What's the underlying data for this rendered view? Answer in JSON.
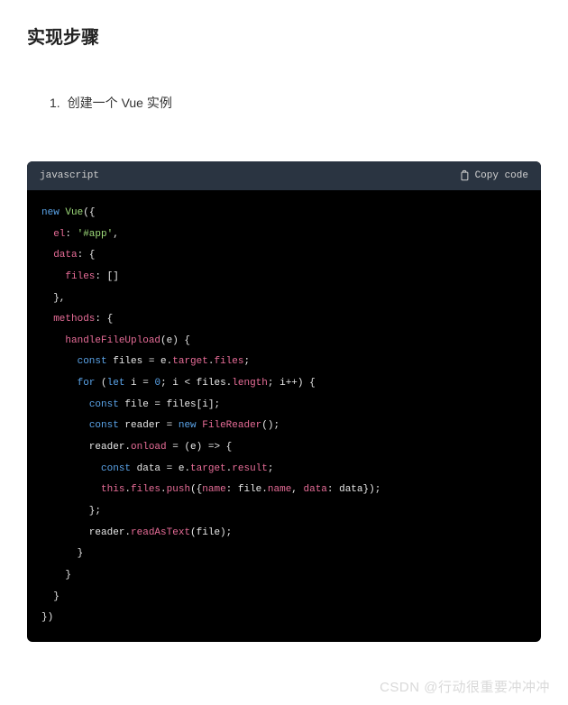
{
  "heading": "实现步骤",
  "list": {
    "number": "1.",
    "text": "创建一个 Vue 实例"
  },
  "code": {
    "language": "javascript",
    "copy_label": "Copy code",
    "lines": [
      [
        {
          "cls": "tk-kw",
          "t": "new"
        },
        {
          "cls": "tk-ident",
          "t": " "
        },
        {
          "cls": "tk-cls",
          "t": "Vue"
        },
        {
          "cls": "tk-punc",
          "t": "({"
        }
      ],
      [
        {
          "cls": "tk-ident",
          "t": "  "
        },
        {
          "cls": "tk-prop",
          "t": "el"
        },
        {
          "cls": "tk-punc",
          "t": ": "
        },
        {
          "cls": "tk-str",
          "t": "'#app'"
        },
        {
          "cls": "tk-punc",
          "t": ","
        }
      ],
      [
        {
          "cls": "tk-ident",
          "t": "  "
        },
        {
          "cls": "tk-prop",
          "t": "data"
        },
        {
          "cls": "tk-punc",
          "t": ": {"
        }
      ],
      [
        {
          "cls": "tk-ident",
          "t": "    "
        },
        {
          "cls": "tk-prop",
          "t": "files"
        },
        {
          "cls": "tk-punc",
          "t": ": []"
        }
      ],
      [
        {
          "cls": "tk-punc",
          "t": "  },"
        }
      ],
      [
        {
          "cls": "tk-ident",
          "t": "  "
        },
        {
          "cls": "tk-prop",
          "t": "methods"
        },
        {
          "cls": "tk-punc",
          "t": ": {"
        }
      ],
      [
        {
          "cls": "tk-ident",
          "t": "    "
        },
        {
          "cls": "tk-method",
          "t": "handleFileUpload"
        },
        {
          "cls": "tk-punc",
          "t": "(e) {"
        }
      ],
      [
        {
          "cls": "tk-ident",
          "t": "      "
        },
        {
          "cls": "tk-kw",
          "t": "const"
        },
        {
          "cls": "tk-ident",
          "t": " files = e."
        },
        {
          "cls": "tk-prop",
          "t": "target"
        },
        {
          "cls": "tk-punc",
          "t": "."
        },
        {
          "cls": "tk-prop",
          "t": "files"
        },
        {
          "cls": "tk-punc",
          "t": ";"
        }
      ],
      [
        {
          "cls": "tk-ident",
          "t": "      "
        },
        {
          "cls": "tk-kw",
          "t": "for"
        },
        {
          "cls": "tk-punc",
          "t": " ("
        },
        {
          "cls": "tk-kw",
          "t": "let"
        },
        {
          "cls": "tk-ident",
          "t": " i = "
        },
        {
          "cls": "tk-num",
          "t": "0"
        },
        {
          "cls": "tk-punc",
          "t": "; i < files."
        },
        {
          "cls": "tk-prop",
          "t": "length"
        },
        {
          "cls": "tk-punc",
          "t": "; i++) {"
        }
      ],
      [
        {
          "cls": "tk-ident",
          "t": "        "
        },
        {
          "cls": "tk-kw",
          "t": "const"
        },
        {
          "cls": "tk-ident",
          "t": " file = files[i];"
        }
      ],
      [
        {
          "cls": "tk-ident",
          "t": "        "
        },
        {
          "cls": "tk-kw",
          "t": "const"
        },
        {
          "cls": "tk-ident",
          "t": " reader = "
        },
        {
          "cls": "tk-kw",
          "t": "new"
        },
        {
          "cls": "tk-ident",
          "t": " "
        },
        {
          "cls": "tk-method",
          "t": "FileReader"
        },
        {
          "cls": "tk-punc",
          "t": "();"
        }
      ],
      [
        {
          "cls": "tk-ident",
          "t": "        reader."
        },
        {
          "cls": "tk-prop",
          "t": "onload"
        },
        {
          "cls": "tk-ident",
          "t": " = (e) => {"
        }
      ],
      [
        {
          "cls": "tk-ident",
          "t": "          "
        },
        {
          "cls": "tk-kw",
          "t": "const"
        },
        {
          "cls": "tk-ident",
          "t": " data = e."
        },
        {
          "cls": "tk-prop",
          "t": "target"
        },
        {
          "cls": "tk-punc",
          "t": "."
        },
        {
          "cls": "tk-prop",
          "t": "result"
        },
        {
          "cls": "tk-punc",
          "t": ";"
        }
      ],
      [
        {
          "cls": "tk-ident",
          "t": "          "
        },
        {
          "cls": "tk-this",
          "t": "this"
        },
        {
          "cls": "tk-punc",
          "t": "."
        },
        {
          "cls": "tk-prop",
          "t": "files"
        },
        {
          "cls": "tk-punc",
          "t": "."
        },
        {
          "cls": "tk-method",
          "t": "push"
        },
        {
          "cls": "tk-punc",
          "t": "({"
        },
        {
          "cls": "tk-prop",
          "t": "name"
        },
        {
          "cls": "tk-punc",
          "t": ": file."
        },
        {
          "cls": "tk-prop",
          "t": "name"
        },
        {
          "cls": "tk-punc",
          "t": ", "
        },
        {
          "cls": "tk-prop",
          "t": "data"
        },
        {
          "cls": "tk-punc",
          "t": ": data});"
        }
      ],
      [
        {
          "cls": "tk-punc",
          "t": "        };"
        }
      ],
      [
        {
          "cls": "tk-ident",
          "t": "        reader."
        },
        {
          "cls": "tk-method",
          "t": "readAsText"
        },
        {
          "cls": "tk-punc",
          "t": "(file);"
        }
      ],
      [
        {
          "cls": "tk-punc",
          "t": "      }"
        }
      ],
      [
        {
          "cls": "tk-punc",
          "t": "    }"
        }
      ],
      [
        {
          "cls": "tk-punc",
          "t": "  }"
        }
      ],
      [
        {
          "cls": "tk-punc",
          "t": "})"
        }
      ]
    ]
  },
  "watermark": "CSDN @行动很重要冲冲冲"
}
